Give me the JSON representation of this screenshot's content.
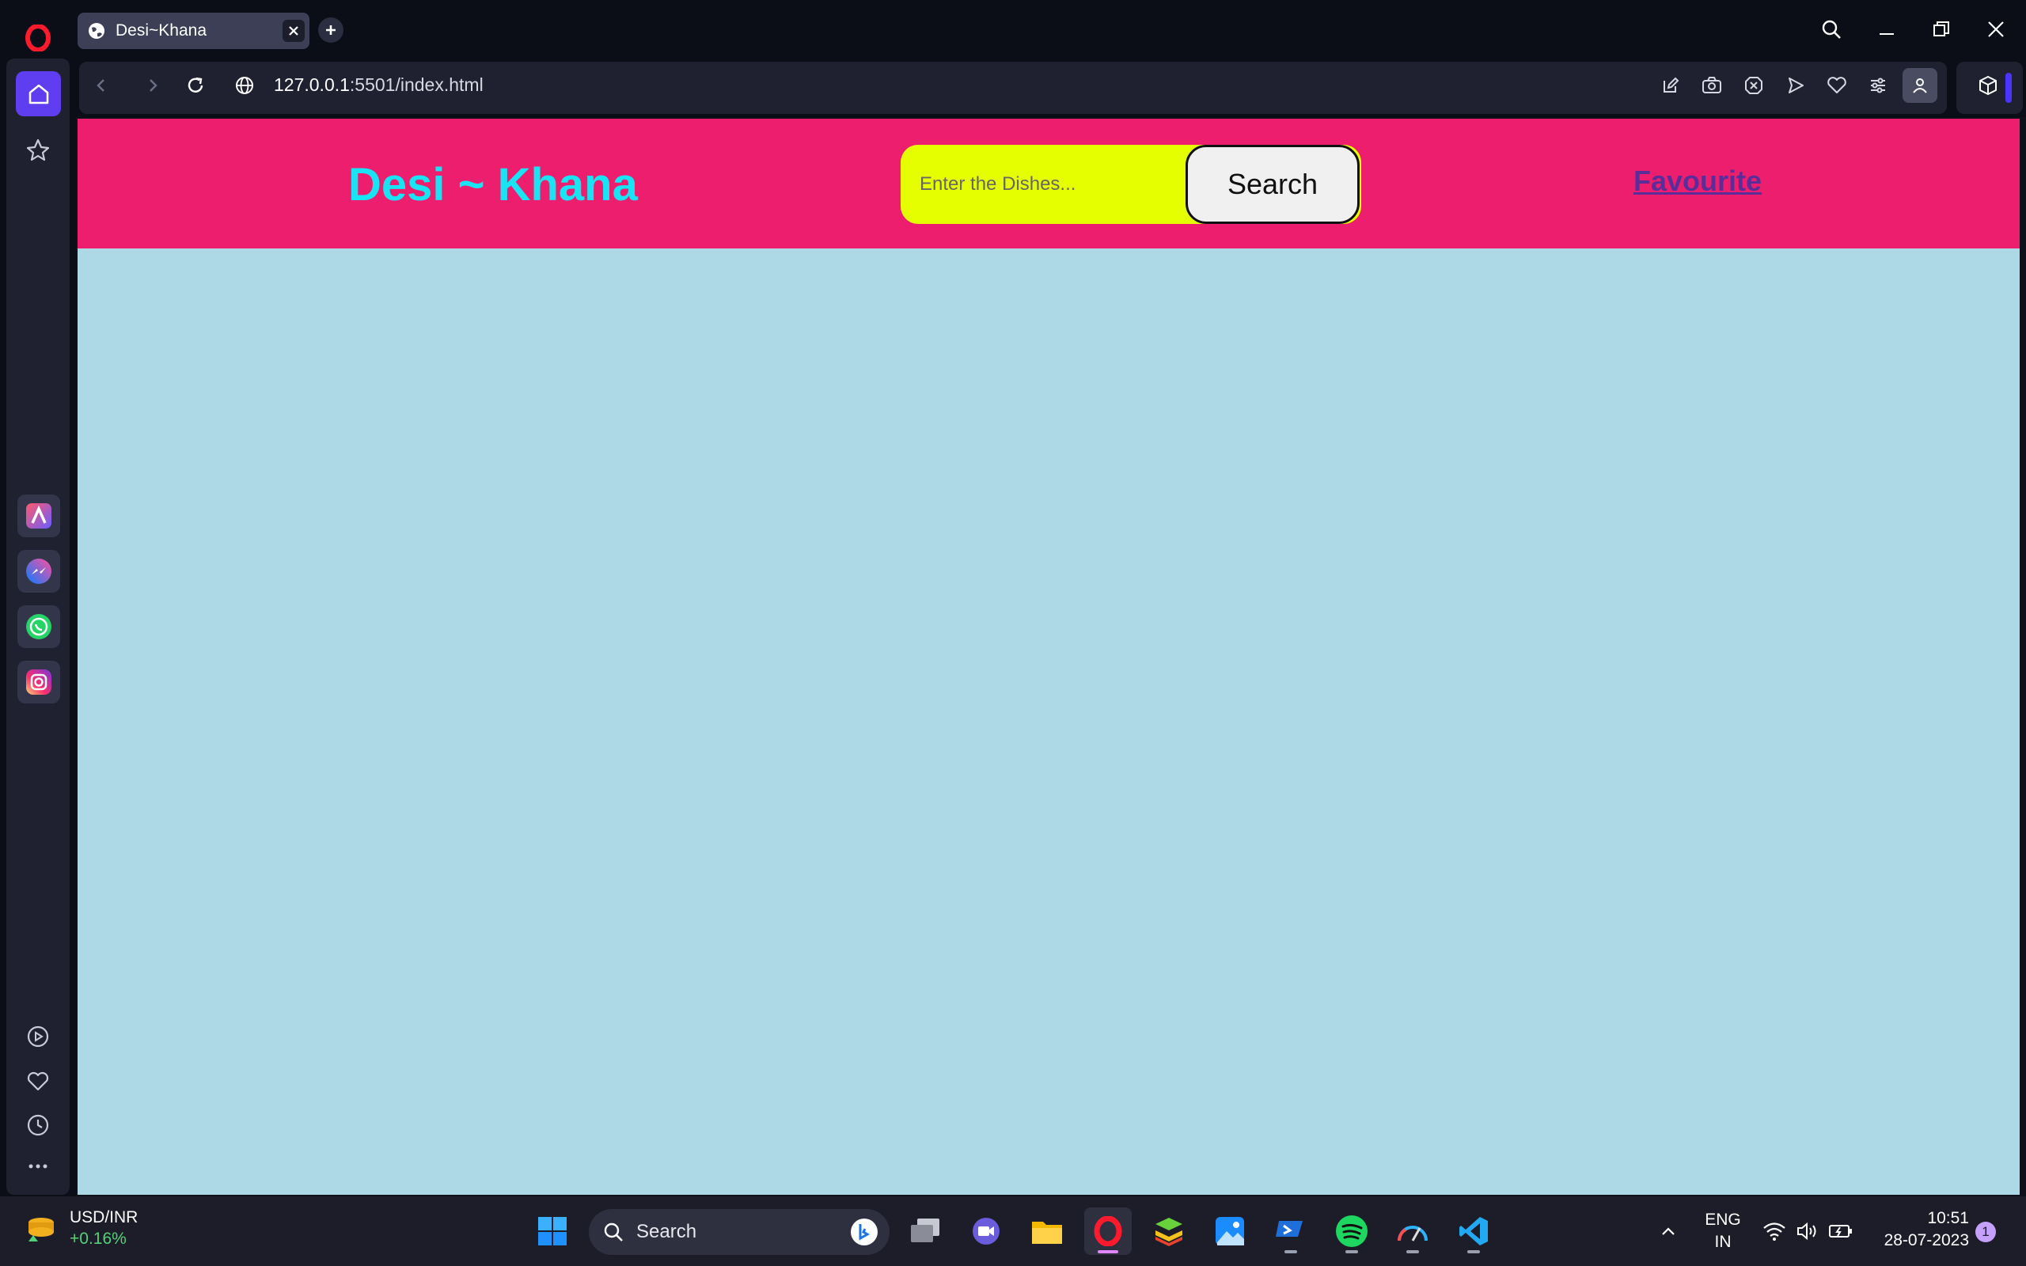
{
  "browser": {
    "tab": {
      "title": "Desi~Khana"
    },
    "address": {
      "host": "127.0.0.1",
      "rest": ":5501/index.html"
    }
  },
  "page": {
    "brand": "Desi ~ Khana",
    "search": {
      "placeholder": "Enter the Dishes...",
      "value": "",
      "button_label": "Search"
    },
    "favourite_link": "Favourite",
    "colors": {
      "header": "#ee1e6e",
      "body": "#add8e6",
      "brand": "#19e4f4",
      "search_bg": "#e6ff00"
    }
  },
  "taskbar": {
    "ticker": {
      "pair": "USD/INR",
      "change": "+0.16%"
    },
    "search_label": "Search",
    "language": {
      "line1": "ENG",
      "line2": "IN"
    },
    "clock": {
      "time": "10:51",
      "date": "28-07-2023"
    },
    "notification_count": "1"
  }
}
